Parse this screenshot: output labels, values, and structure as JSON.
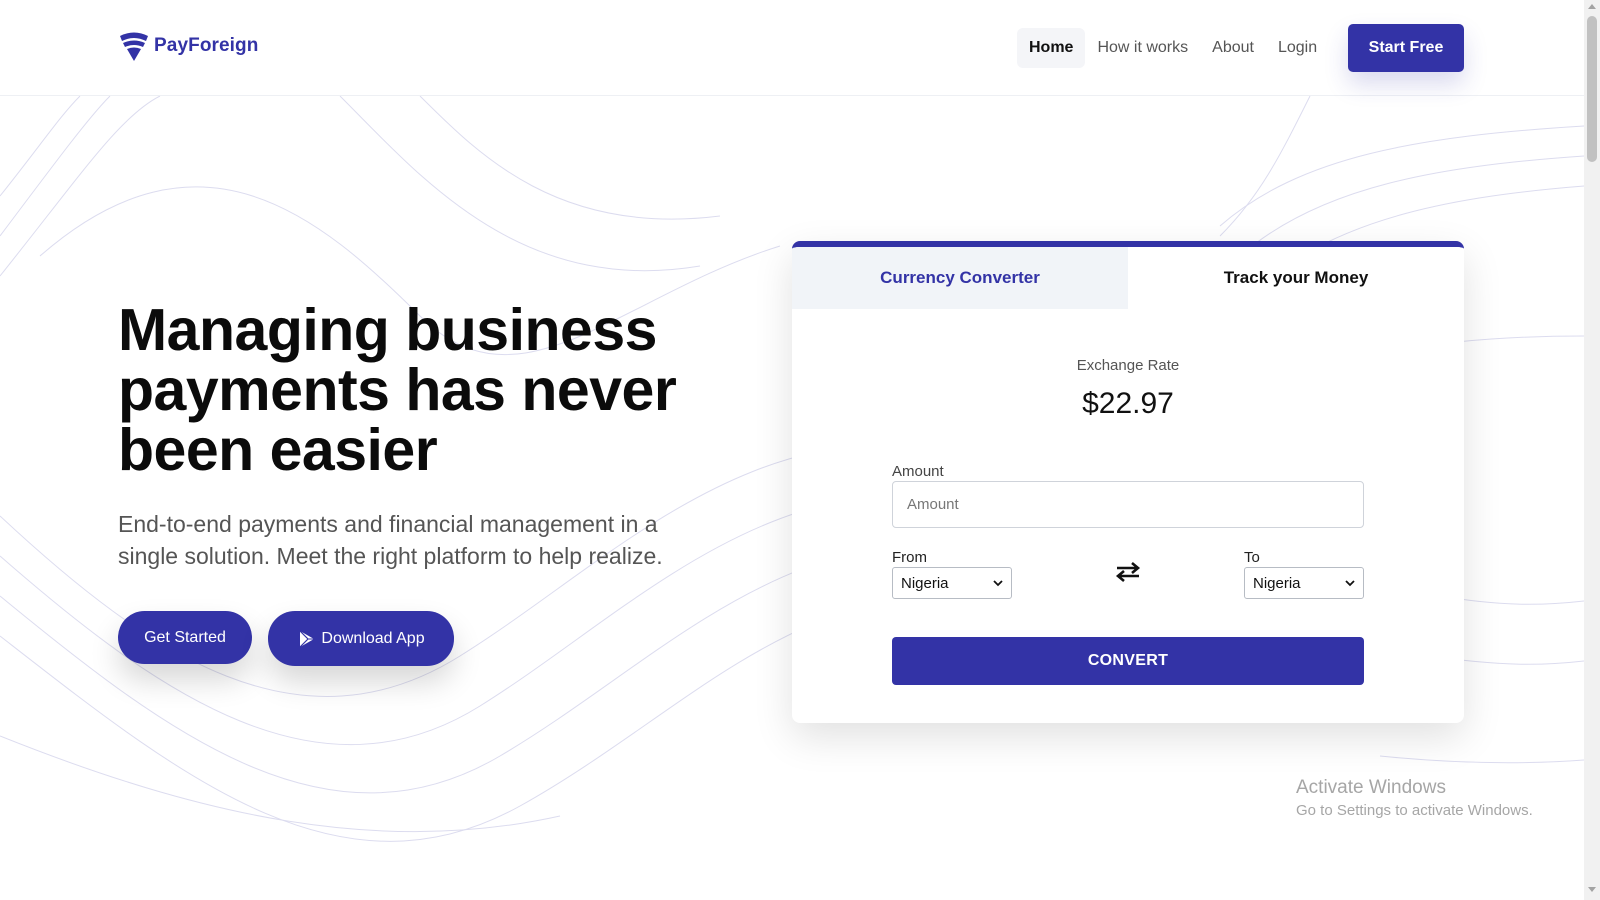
{
  "brand": {
    "name": "PayForeign",
    "accent": "#3333a6"
  },
  "nav": {
    "items": [
      "Home",
      "How it works",
      "About",
      "Login"
    ],
    "active": "Home",
    "cta": "Start Free"
  },
  "hero": {
    "title": "Managing business payments has never been easier",
    "subtitle": "End-to-end payments and financial management in a single solution. Meet the right platform to help realize.",
    "get_started": "Get Started",
    "download_app": "Download App"
  },
  "card": {
    "tabs": [
      "Currency Converter",
      "Track your Money"
    ],
    "active_tab": "Currency Converter",
    "rate_label": "Exchange Rate",
    "rate_value": "$22.97",
    "amount_label": "Amount",
    "amount_placeholder": "Amount",
    "from_label": "From",
    "from_value": "Nigeria",
    "to_label": "To",
    "to_value": "Nigeria",
    "convert": "CONVERT"
  },
  "watermark": {
    "title": "Activate Windows",
    "subtitle": "Go to Settings to activate Windows."
  }
}
